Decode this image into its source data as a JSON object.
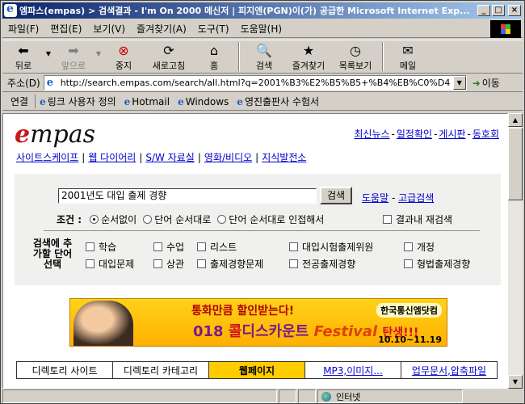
{
  "window": {
    "title": "엠파스(empas) > 검색결과 - I'm On 2000 메신저 | 피지엔(PGN)이(가) 공급한 Microsoft Internet Exp...",
    "controls": {
      "minimize": "_",
      "maximize": "□",
      "close": "×"
    }
  },
  "menu": [
    "파일(F)",
    "편집(E)",
    "보기(V)",
    "즐겨찾기(A)",
    "도구(T)",
    "도움말(H)"
  ],
  "toolbar": {
    "back": "뒤로",
    "forward": "앞으로",
    "stop": "중지",
    "refresh": "새로고침",
    "home": "홈",
    "search": "검색",
    "favorites": "즐겨찾기",
    "history": "목록보기",
    "mail": "메일"
  },
  "address": {
    "label": "주소(D)",
    "url": "http://search.empas.com/search/all.html?q=2001%B3%E2%B5%B5+%B4%EB%C0%D4",
    "go": "이동"
  },
  "links": {
    "label": "연결",
    "items": [
      "링크 사용자 정의",
      "Hotmail",
      "Windows",
      "영진출판사 수험서"
    ]
  },
  "page": {
    "logo_e": "e",
    "logo_rest": "mpas",
    "toplinks": [
      "최신뉴스",
      "일정확인",
      "게시판",
      "동호회"
    ],
    "dash": "-",
    "categories": [
      "사이트스케이프",
      "웹 다이어리",
      "S/W 자료실",
      "영화/비디오",
      "지식발전소"
    ],
    "search": {
      "query": "2001년도 대입 출제 경향",
      "button": "검색",
      "help": "도움말",
      "advanced": "고급검색",
      "condition_label": "조건 :",
      "options": [
        "순서없이",
        "단어 순서대로",
        "단어 순서대로 인접해서"
      ],
      "selected_option": 0,
      "within_results": "결과내 재검색",
      "term_label": "검색에 추가할 단어 선택",
      "terms": [
        [
          "학습",
          "수업",
          "리스트",
          "대입시험출제위원",
          "개정"
        ],
        [
          "대입문제",
          "상관",
          "출제경향문제",
          "전공출제경향",
          "형법출제경향"
        ]
      ]
    },
    "banner": {
      "line1": "통화만큼 할인받는다!",
      "num": "018",
      "ko": "콜",
      "discount": "디스카운트",
      "festival": "Festival",
      "tan": "탄생!!!",
      "brand": "한국통신엠닷컴",
      "dates": "10.10~11.19"
    },
    "tabs": [
      "디렉토리 사이트",
      "디렉토리 카테고리",
      "웹페이지",
      "MP3,이미지...",
      "업무문서,압축파일"
    ],
    "active_tab": 2
  },
  "status": {
    "zone": "인터넷"
  }
}
